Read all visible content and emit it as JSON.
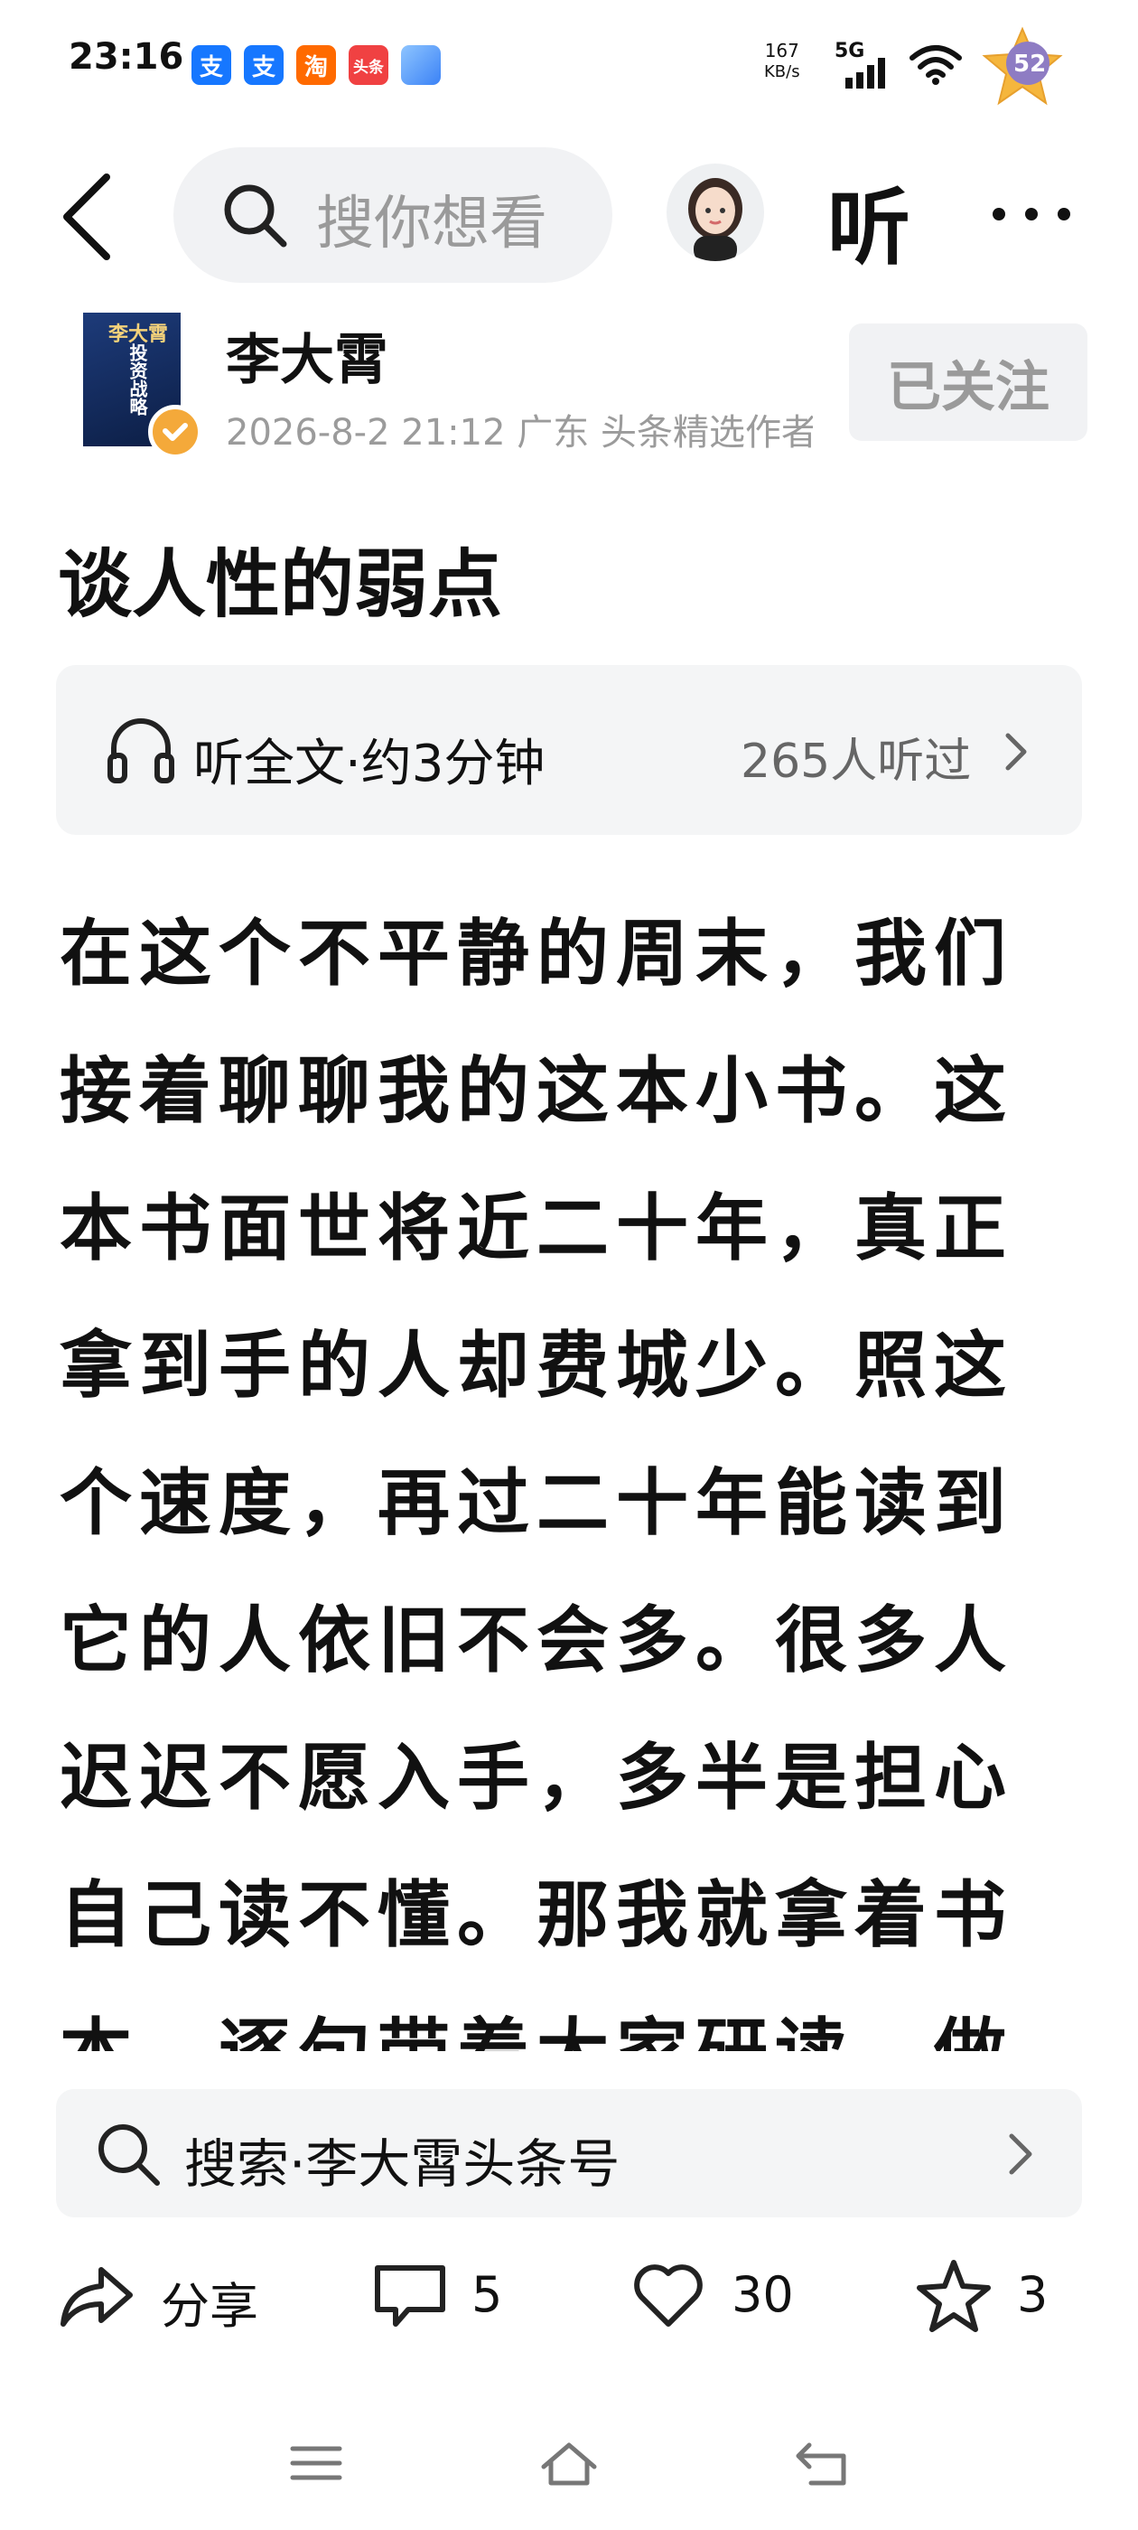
{
  "status": {
    "time": "23:16",
    "apps": [
      {
        "icon": "alipay-icon",
        "glyph": "支",
        "color": "#1677ff"
      },
      {
        "icon": "alipay-icon",
        "glyph": "支",
        "color": "#1677ff"
      },
      {
        "icon": "taobao-icon",
        "glyph": "淘",
        "color": "#ff6a00"
      },
      {
        "icon": "toutiao-icon",
        "glyph": "头条",
        "color": "#f04142"
      },
      {
        "icon": "app-icon",
        "glyph": "",
        "color": "#5fa8ff"
      }
    ],
    "net_speed_value": "167",
    "net_speed_unit": "KB/s",
    "network": "5G",
    "badge_count": "52"
  },
  "nav": {
    "search_placeholder": "搜你想看",
    "listen_label": "听"
  },
  "author": {
    "name": "李大霄",
    "meta": "2026-8-2 21:12 广东 头条精选作者",
    "follow_label": "已关注",
    "book_title": "李大霄",
    "book_subtitle": "投资战略"
  },
  "article": {
    "title": "谈人性的弱点",
    "listen_text": "听全文·约3分钟",
    "listen_count": "265人听过",
    "body_lines": [
      "在这个不平静的周末，我们",
      "接着聊聊我的这本小书。这",
      "本书面世将近二十年，真正",
      "拿到手的人却费城少。照这",
      "个速度，再过二十年能读到",
      "它的人依旧不会多。很多人",
      "迟迟不愿入手，多半是担心",
      "自己读不懂。那我就拿着书",
      "本，逐句带着大家研读，做"
    ]
  },
  "search_suggestion": {
    "text": "搜索·李大霄头条号"
  },
  "actions": {
    "share_label": "分享",
    "comment_count": "5",
    "like_count": "30",
    "favorite_count": "3"
  },
  "colors": {
    "card_bg": "#f4f5f6",
    "muted_text": "#9b9b9b",
    "badge_gold": "#f4a93a"
  }
}
